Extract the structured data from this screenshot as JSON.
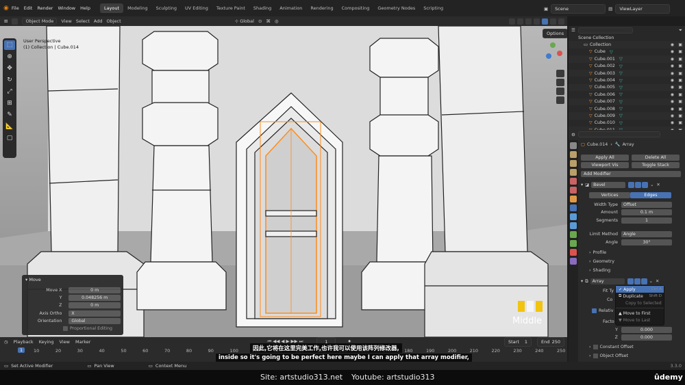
{
  "topbar": {
    "menus": [
      "File",
      "Edit",
      "Render",
      "Window",
      "Help"
    ],
    "workspaces": [
      "Layout",
      "Modeling",
      "Sculpting",
      "UV Editing",
      "Texture Paint",
      "Shading",
      "Animation",
      "Rendering",
      "Compositing",
      "Geometry Nodes",
      "Scripting"
    ],
    "active_workspace": "Layout",
    "scene": "Scene",
    "view_layer": "ViewLayer"
  },
  "viewport_header": {
    "mode": "Object Mode",
    "menus": [
      "View",
      "Select",
      "Add",
      "Object"
    ],
    "transform": "Global",
    "options": "Options"
  },
  "viewport": {
    "perspective": "User Perspective",
    "collection": "(1) Collection | Cube.014"
  },
  "outliner": {
    "scene_collection": "Scene Collection",
    "collection": "Collection",
    "items": [
      "Cube",
      "Cube.001",
      "Cube.002",
      "Cube.003",
      "Cube.004",
      "Cube.005",
      "Cube.006",
      "Cube.007",
      "Cube.008",
      "Cube.009",
      "Cube.010",
      "Cube.011"
    ]
  },
  "properties": {
    "object": "Cube.014",
    "modifier_tab": "Array",
    "apply_all": "Apply All",
    "delete_all": "Delete All",
    "viewport_vis": "Viewport Vis",
    "toggle_stack": "Toggle Stack",
    "add_modifier": "Add Modifier",
    "bevel": {
      "name": "Bevel",
      "tabs": [
        "Vertices",
        "Edges"
      ],
      "active_tab": "Edges",
      "width_type_label": "Width Type",
      "width_type": "Offset",
      "amount_label": "Amount",
      "amount": "0.1 m",
      "segments_label": "Segments",
      "segments": "1",
      "limit_method_label": "Limit Method",
      "limit_method": "Angle",
      "angle_label": "Angle",
      "angle": "30°",
      "sections": [
        "Profile",
        "Geometry",
        "Shading"
      ]
    },
    "array": {
      "name": "Array",
      "fit_type_label": "Fit Ty",
      "count_label": "Co",
      "relative_label": "Relativ",
      "factor_label": "Facto",
      "y_label": "Y",
      "y": "0.000",
      "z_label": "Z",
      "z": "0.000",
      "sections": [
        "Constant Offset",
        "Object Offset"
      ]
    }
  },
  "context_menu": [
    {
      "label": "Apply",
      "shortcut": "Ctrl A"
    },
    {
      "label": "Duplicate",
      "shortcut": "Shift D"
    },
    {
      "label": "Copy to Selected",
      "shortcut": ""
    },
    {
      "label": "Move to First",
      "shortcut": ""
    },
    {
      "label": "Move to Last",
      "shortcut": ""
    }
  ],
  "operator_panel": {
    "title": "Move",
    "move_x_label": "Move X",
    "move_x": "0 m",
    "y_label": "Y",
    "y": "0.048256 m",
    "z_label": "Z",
    "z": "0 m",
    "axis_ortho_label": "Axis Ortho",
    "axis_ortho": "X",
    "orientation_label": "Orientation",
    "orientation": "Global",
    "proportional": "Proportional Editing"
  },
  "timeline": {
    "menus": [
      "Playback",
      "Keying",
      "View",
      "Marker"
    ],
    "current_frame": "1",
    "start_label": "Start",
    "start": "1",
    "end_label": "End",
    "end": "250",
    "ticks": [
      "10",
      "20",
      "30",
      "40",
      "50",
      "60",
      "70",
      "80",
      "90",
      "100",
      "110",
      "120",
      "130",
      "140",
      "150",
      "160",
      "170",
      "180",
      "190",
      "200",
      "210",
      "220",
      "230",
      "240",
      "250"
    ]
  },
  "statusbar": {
    "items": [
      "Set Active Modifier",
      "Pan View",
      "Context Menu"
    ],
    "version": "3.3.0"
  },
  "subtitles": {
    "chinese": "因此,它将在这里完美工作,也许我可以使用该阵列修改器,",
    "english": "inside so it's going to be perfect here maybe I can apply that array modifier,"
  },
  "watermark": {
    "middle": "Middle"
  },
  "footer": {
    "site": "Site: artstudio313.net",
    "youtube": "Youtube: artstudio313",
    "brand": "ûdemy"
  },
  "colors": {
    "accent": "#4772b3",
    "orange": "#ff9a3a",
    "watermark_yellow": "#f1c40f"
  }
}
